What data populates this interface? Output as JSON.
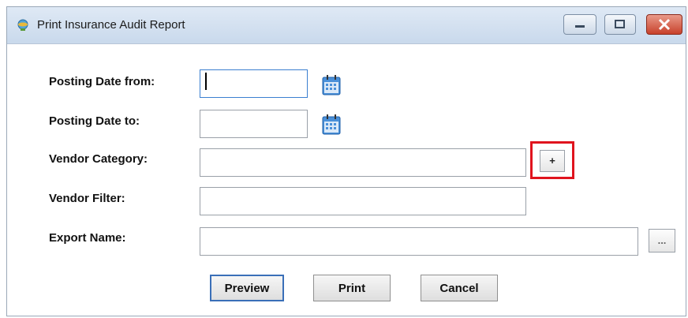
{
  "window": {
    "title": "Print Insurance Audit Report",
    "icons": [
      "app-icon",
      "minimize-icon",
      "maximize-icon",
      "close-icon"
    ]
  },
  "form": {
    "posting_date_from": {
      "label": "Posting Date from:",
      "value": ""
    },
    "posting_date_to": {
      "label": "Posting Date to:",
      "value": ""
    },
    "vendor_category": {
      "label": "Vendor Category:",
      "value": "",
      "button_label": "+"
    },
    "vendor_filter": {
      "label": "Vendor Filter:",
      "value": ""
    },
    "export_name": {
      "label": "Export Name:",
      "value": "",
      "button_label": "..."
    }
  },
  "buttons": {
    "preview": "Preview",
    "print": "Print",
    "cancel": "Cancel"
  },
  "colors": {
    "highlight": "#e0141e",
    "titlebar": "#dfe9f5",
    "close_button": "#c8412b",
    "focus_border": "#3b7fd0"
  }
}
